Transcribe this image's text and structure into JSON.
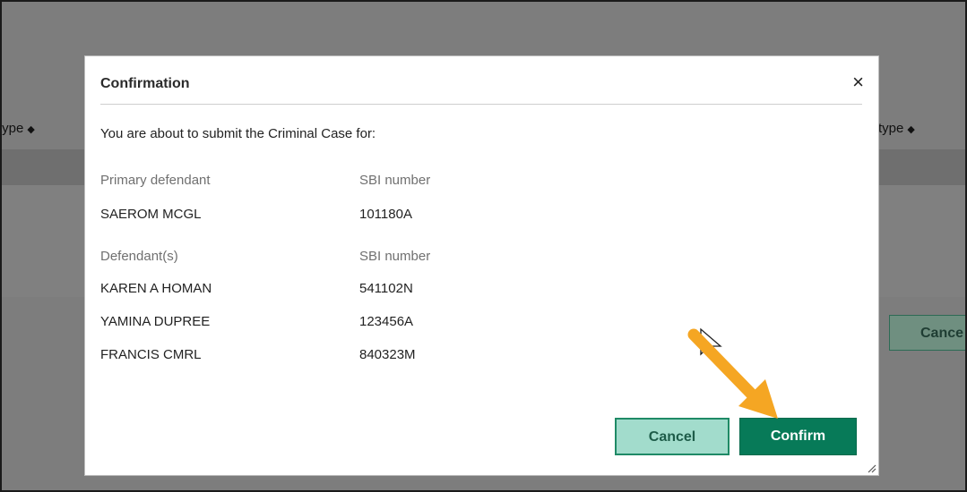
{
  "background": {
    "col_left_header": "type",
    "col_right_header": "type",
    "cancel_label": "Cance"
  },
  "dialog": {
    "title": "Confirmation",
    "close_glyph": "×",
    "intro": "You are about to submit the Criminal Case for:",
    "primary": {
      "name_label": "Primary defendant",
      "sbi_label": "SBI number",
      "name": "SAEROM MCGL",
      "sbi": "101180A"
    },
    "defendants": {
      "name_label": "Defendant(s)",
      "sbi_label": "SBI number",
      "rows": [
        {
          "name": "KAREN A HOMAN",
          "sbi": "541102N"
        },
        {
          "name": "YAMINA DUPREE",
          "sbi": "123456A"
        },
        {
          "name": "FRANCIS CMRL",
          "sbi": "840323M"
        }
      ]
    },
    "buttons": {
      "cancel": "Cancel",
      "confirm": "Confirm"
    }
  },
  "colors": {
    "confirm": "#077a58",
    "cancel_fill": "#a2dccc",
    "annotation_arrow": "#f5a623"
  },
  "icons": [
    "sort-icon",
    "close-icon",
    "resize-grip-icon",
    "pointer-cursor-icon",
    "annotation-arrow-icon"
  ]
}
